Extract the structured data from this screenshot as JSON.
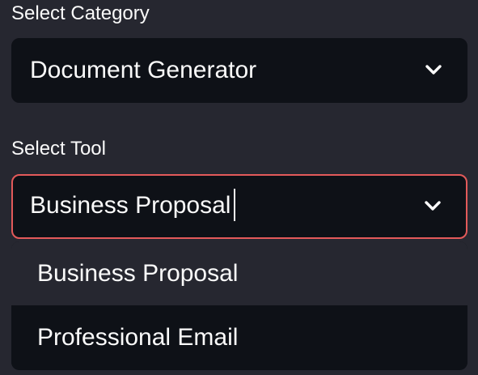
{
  "category": {
    "label": "Select Category",
    "selected": "Document Generator"
  },
  "tool": {
    "label": "Select Tool",
    "input_value": "Business Proposal",
    "options": [
      "Business Proposal",
      "Professional Email"
    ]
  },
  "colors": {
    "background": "#262730",
    "input_background": "#0e1117",
    "focus_border": "#e35a5a",
    "text": "#fafafa",
    "option_hover": "#262730"
  },
  "icons": {
    "dropdown": "chevron-down-icon"
  }
}
